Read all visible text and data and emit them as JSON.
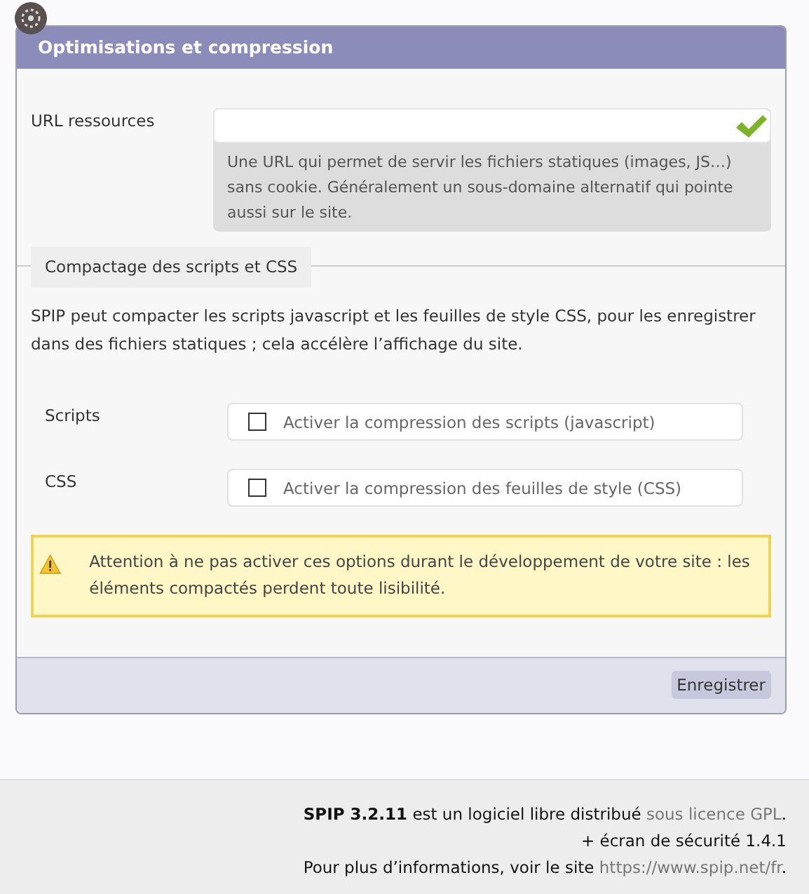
{
  "panel": {
    "title": "Optimisations et compression"
  },
  "url_field": {
    "label": "URL ressources",
    "explanation": "Une URL qui permet de servir les fichiers statiques (images, JS…) sans cookie. Généralement un sous-domaine alternatif qui pointe aussi sur le site."
  },
  "fieldset": {
    "legend": "Compactage des scripts et CSS",
    "intro": "SPIP peut compacter les scripts javascript et les feuilles de style CSS, pour les enregistrer dans des fichiers statiques ; cela accélère l’affichage du site.",
    "options": [
      {
        "label": "Scripts",
        "text": "Activer la compression des scripts (javascript)",
        "checked": false
      },
      {
        "label": "CSS",
        "text": "Activer la compression des feuilles de style (CSS)",
        "checked": false
      }
    ],
    "warning": "Attention à ne pas activer ces options durant le développement de votre site : les éléments compactés perdent toute lisibilité."
  },
  "submit": "Enregistrer",
  "footer": {
    "line_1": {
      "text": "**SPIP 3.2.11** est un logiciel libre distribué ",
      "link": "sous licence GPL",
      "end": "."
    },
    "line_2": "+ écran de sécurité 1.4.1",
    "line_3": {
      "text": "Pour plus d’informations, voir le site ",
      "link": "https://www.spip.net/fr",
      "end": "."
    }
  }
}
